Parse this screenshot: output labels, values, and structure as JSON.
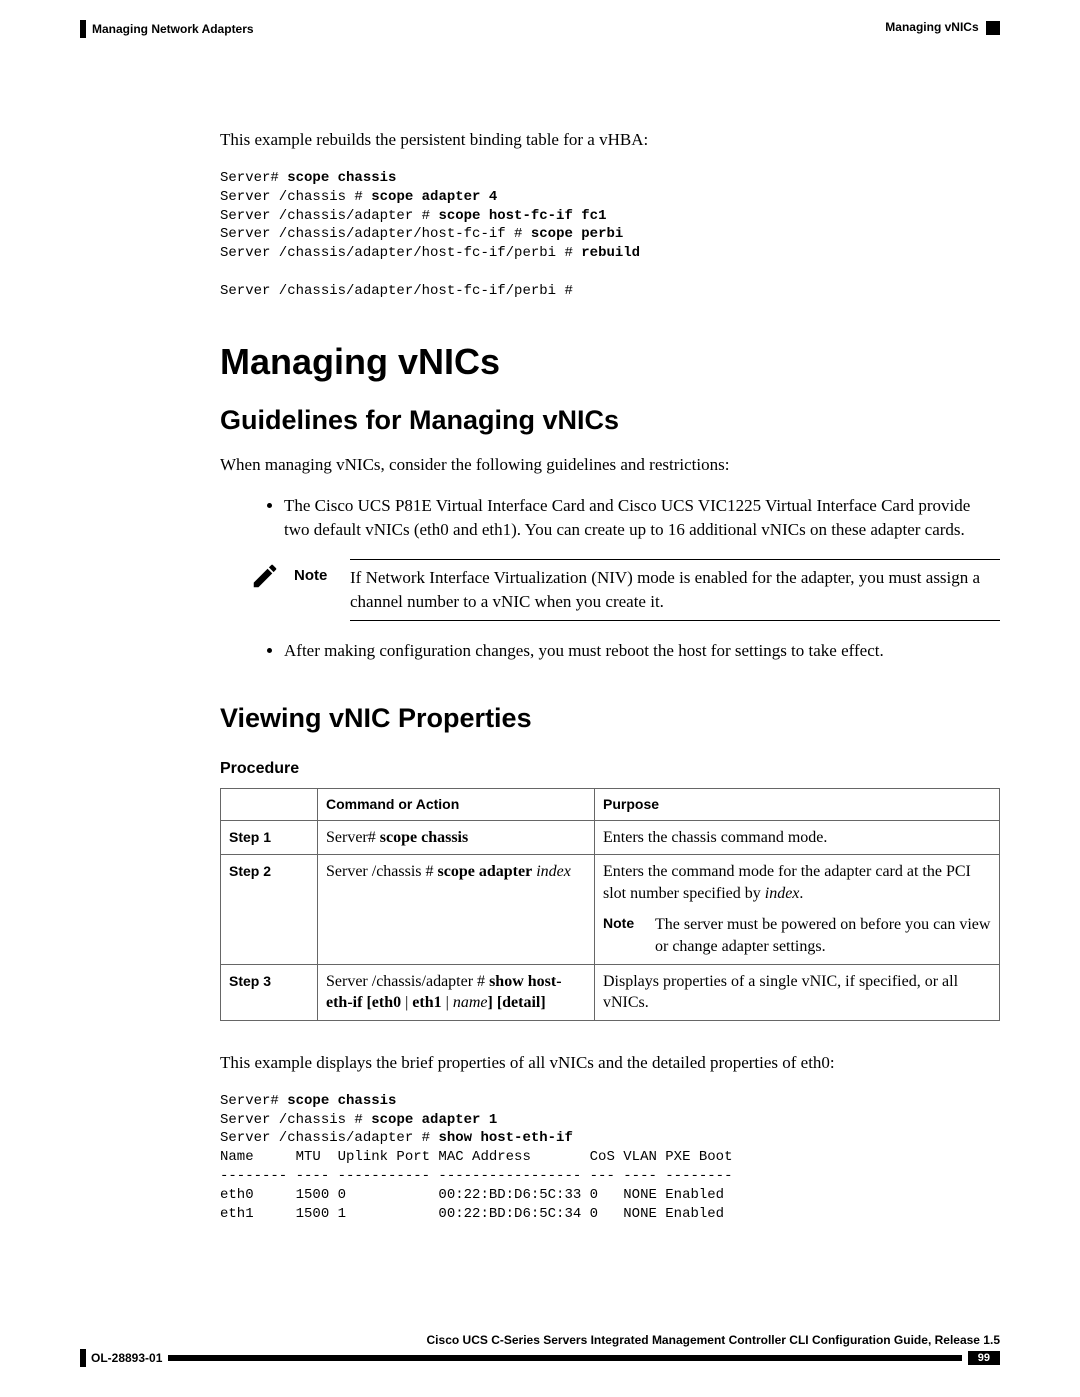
{
  "header": {
    "left": "Managing Network Adapters",
    "right": "Managing vNICs"
  },
  "intro_example": "This example rebuilds the persistent binding table for a vHBA:",
  "code1_plain1": "Server# ",
  "code1_bold1": "scope chassis",
  "code1_plain2": "Server /chassis # ",
  "code1_bold2": "scope adapter 4",
  "code1_plain3": "Server /chassis/adapter # ",
  "code1_bold3": "scope host-fc-if fc1",
  "code1_plain4": "Server /chassis/adapter/host-fc-if # ",
  "code1_bold4": "scope perbi",
  "code1_plain5": "Server /chassis/adapter/host-fc-if/perbi # ",
  "code1_bold5": "rebuild",
  "code1_plain6": "Server /chassis/adapter/host-fc-if/perbi #",
  "h1": "Managing vNICs",
  "h2a": "Guidelines for Managing vNICs",
  "guidelines_intro": "When managing vNICs, consider the following guidelines and restrictions:",
  "bullet1": "The Cisco UCS P81E Virtual Interface Card and Cisco UCS VIC1225 Virtual Interface Card provide two default vNICs (eth0 and eth1). You can create up to 16 additional vNICs on these adapter cards.",
  "note_label": "Note",
  "note_body": "If Network Interface Virtualization (NIV) mode is enabled for the adapter, you must assign a channel number to a vNIC when you create it.",
  "bullet2": "After making configuration changes, you must reboot the host for settings to take effect.",
  "h2b": "Viewing vNIC Properties",
  "procedure_label": "Procedure",
  "th_step": "",
  "th_cmd": "Command or Action",
  "th_purpose": "Purpose",
  "steps": {
    "s1": "Step 1",
    "s2": "Step 2",
    "s3": "Step 3"
  },
  "row1_cmd_a": "Server# ",
  "row1_cmd_b": "scope chassis",
  "row1_purpose": "Enters the chassis command mode.",
  "row2_cmd_a": "Server /chassis # ",
  "row2_cmd_b": "scope adapter",
  "row2_cmd_c": " index",
  "row2_purpose_a": "Enters the command mode for the adapter card at the PCI slot number specified by ",
  "row2_purpose_b": "index",
  "row2_purpose_c": ".",
  "row2_note_label": "Note",
  "row2_note_body": "The server must be powered on before you can view or change adapter settings.",
  "row3_cmd_a": "Server /chassis/adapter # ",
  "row3_cmd_b": "show host-eth-if",
  "row3_cmd_c": " [",
  "row3_cmd_d": "eth0",
  "row3_cmd_e": " | ",
  "row3_cmd_f": "eth1",
  "row3_cmd_g": " | ",
  "row3_cmd_h": "name",
  "row3_cmd_i": "] [",
  "row3_cmd_j": "detail",
  "row3_cmd_k": "]",
  "row3_purpose": "Displays properties of a single vNIC, if specified, or all vNICs.",
  "example2_intro": "This example displays the brief properties of all vNICs and the detailed properties of eth0:",
  "code2_p1": "Server# ",
  "code2_b1": "scope chassis",
  "code2_p2": "Server /chassis # ",
  "code2_b2": "scope adapter 1",
  "code2_p3": "Server /chassis/adapter # ",
  "code2_b3": "show host-eth-if",
  "code2_table": "Name     MTU  Uplink Port MAC Address       CoS VLAN PXE Boot\n-------- ---- ----------- ----------------- --- ---- --------\neth0     1500 0           00:22:BD:D6:5C:33 0   NONE Enabled\neth1     1500 1           00:22:BD:D6:5C:34 0   NONE Enabled",
  "footer_guide": "Cisco UCS C-Series Servers Integrated Management Controller CLI Configuration Guide, Release 1.5",
  "footer_doc": "OL-28893-01",
  "footer_page": "99"
}
